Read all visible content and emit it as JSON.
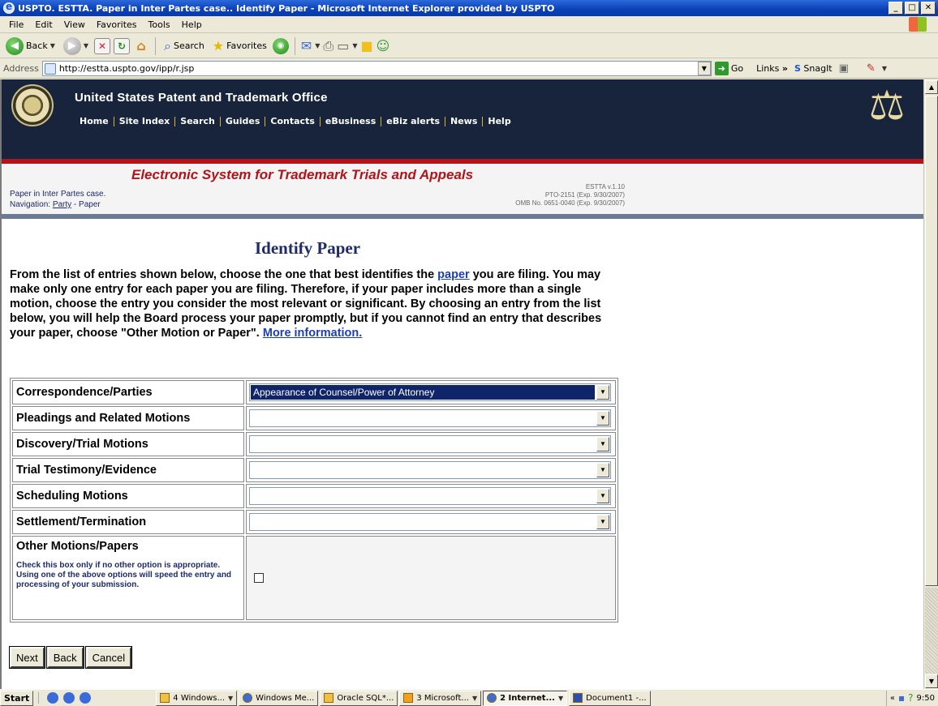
{
  "window": {
    "title": "USPTO. ESTTA. Paper in Inter Partes case.. Identify Paper - Microsoft Internet Explorer provided by USPTO",
    "buttons": [
      "_",
      "□",
      "✕"
    ]
  },
  "menu": [
    "File",
    "Edit",
    "View",
    "Favorites",
    "Tools",
    "Help"
  ],
  "toolbar": {
    "back_label": "Back",
    "search_label": "Search",
    "favorites_label": "Favorites"
  },
  "address": {
    "label": "Address",
    "url": "http://estta.uspto.gov/ipp/r.jsp",
    "go_label": "Go",
    "links_label": "Links",
    "links_chevron": "»",
    "snagit_label": "SnagIt"
  },
  "header": {
    "org_name": "United States Patent and Trademark Office",
    "nav": [
      "Home",
      "Site Index",
      "Search",
      "Guides",
      "Contacts",
      "eBusiness",
      "eBiz alerts",
      "News",
      "Help"
    ]
  },
  "estta": {
    "title": "Electronic System for Trademark Trials and Appeals",
    "case_line": "Paper in Inter Partes case.",
    "nav_prefix": "Navigation: ",
    "nav_link": "Party",
    "nav_suffix": " - Paper",
    "version": "ESTTA v.1.10",
    "pto": "PTO-2151 (Exp. 9/30/2007)",
    "omb": "OMB No. 0651-0040 (Exp. 9/30/2007)"
  },
  "page": {
    "title": "Identify Paper",
    "intro_part1": "From the list of entries shown below, choose the one that best identifies the ",
    "intro_link": "paper",
    "intro_part2": " you are filing. You may make only one entry for each paper you are filing. Therefore, if your paper includes more than a single motion, choose the entry you consider the most relevant or significant. By choosing an entry from the list below, you will help the Board process your paper promptly, but if you cannot find an entry that describes your paper, choose \"Other Motion or Paper\". ",
    "more_info": "More information."
  },
  "categories": [
    {
      "label": "Correspondence/Parties",
      "selected": "Appearance of Counsel/Power of Attorney"
    },
    {
      "label": "Pleadings and Related Motions",
      "selected": ""
    },
    {
      "label": "Discovery/Trial Motions",
      "selected": ""
    },
    {
      "label": "Trial Testimony/Evidence",
      "selected": ""
    },
    {
      "label": "Scheduling Motions",
      "selected": ""
    },
    {
      "label": "Settlement/Termination",
      "selected": ""
    }
  ],
  "other": {
    "title": "Other Motions/Papers",
    "help": "Check this box only if no other option is appropriate. Using one of the above options will speed the entry and processing of your submission."
  },
  "buttons": {
    "next": "Next",
    "back": "Back",
    "cancel": "Cancel"
  },
  "taskbar": {
    "start": "Start",
    "items": [
      {
        "label": "4 Windows...",
        "active": false
      },
      {
        "label": "Windows Me...",
        "active": false
      },
      {
        "label": "Oracle SQL*...",
        "active": false
      },
      {
        "label": "3 Microsoft...",
        "active": false
      },
      {
        "label": "2 Internet...",
        "active": true
      },
      {
        "label": "Document1 -...",
        "active": false
      }
    ],
    "tray_chevron": "«",
    "clock": "9:50"
  }
}
